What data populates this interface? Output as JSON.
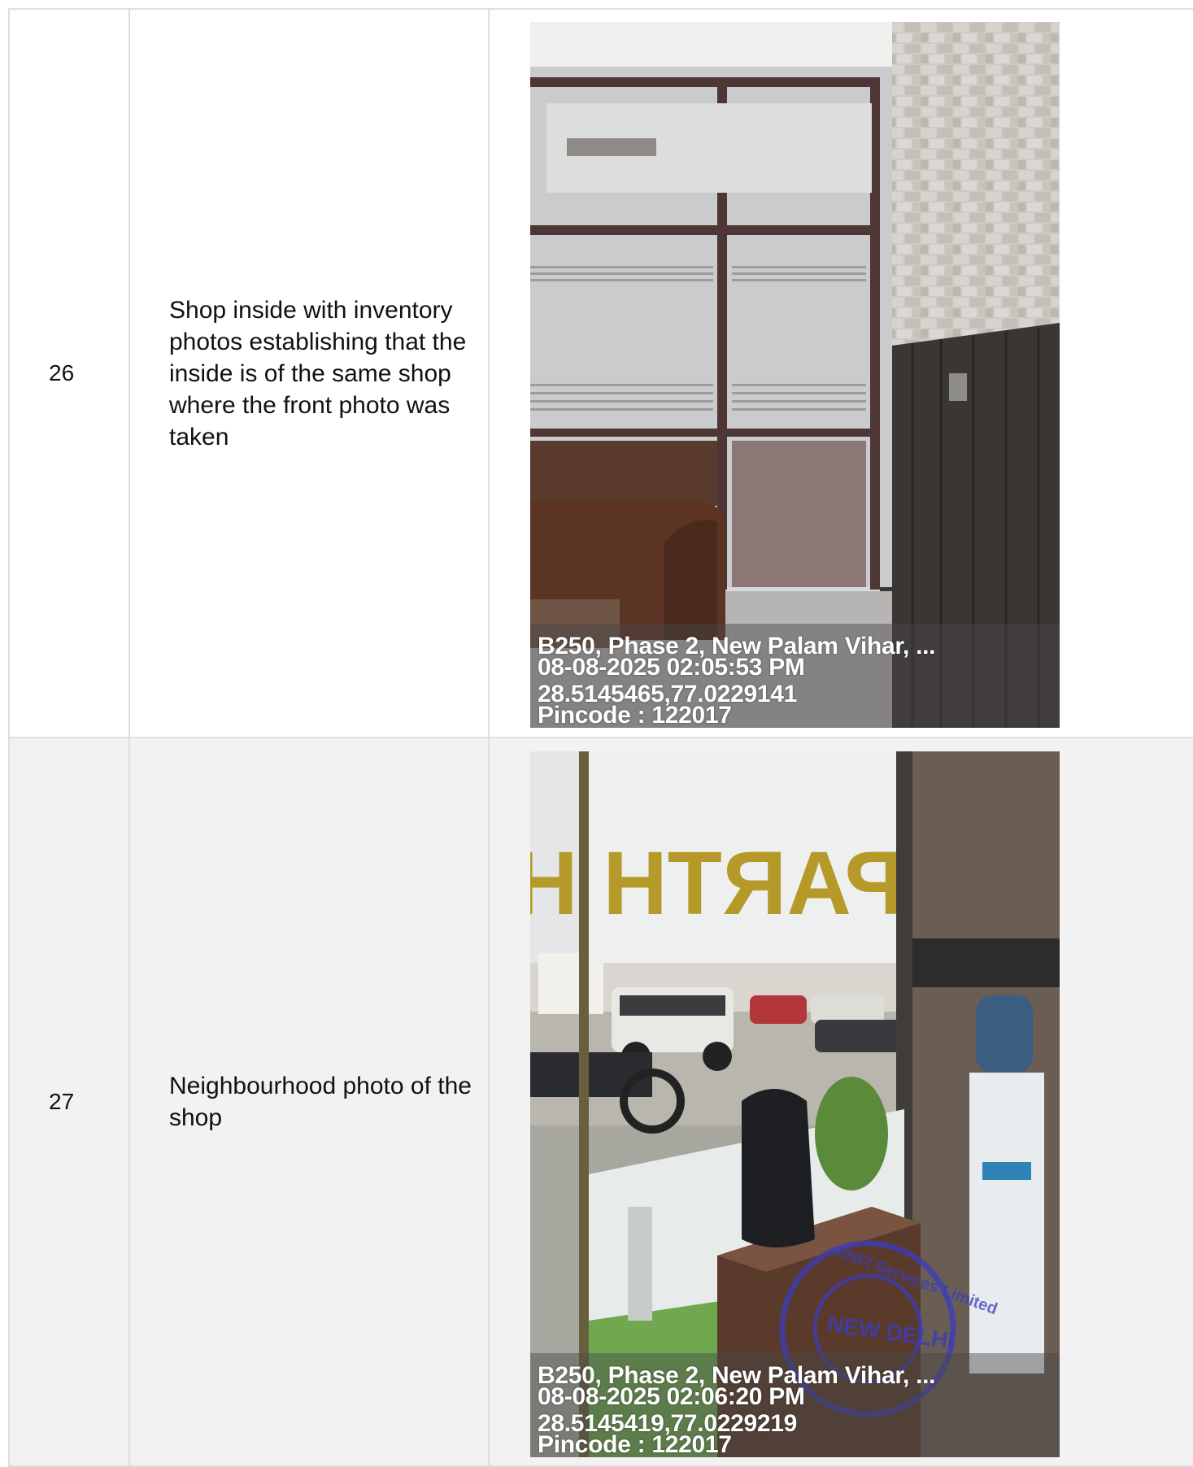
{
  "rows": [
    {
      "number": "26",
      "description": "Shop inside with inventory photos establishing that the inside is of the same shop where the front photo was taken",
      "photo": {
        "address": "B250, Phase 2, New Palam Vihar, ...",
        "datetime": "08-08-2025 02:05:53 PM",
        "coords": "28.5145465,77.0229141",
        "pincode": "Pincode : 122017"
      }
    },
    {
      "number": "27",
      "description": "Neighbourhood photo of the shop",
      "photo": {
        "address": "B250, Phase 2, New Palam Vihar, ...",
        "datetime": "08-08-2025 02:06:20 PM",
        "coords": "28.5145419,77.0229219",
        "pincode": "Pincode : 122017",
        "sign_text": "PARTH HOMZ",
        "seal_text": "RNFI Services Limited · NEW DELHI"
      }
    }
  ]
}
